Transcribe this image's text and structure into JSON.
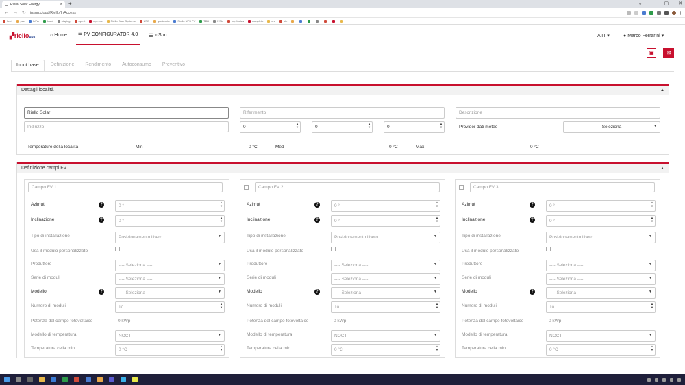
{
  "browser": {
    "tab_title": "Riello Solar Energy",
    "url": "insun.cloud/Riello/InAccess",
    "bookmarks": [
      "fleet",
      "pvc",
      "IUFA",
      "Inout",
      "staging",
      "ope.it",
      "ope.rec",
      "Riello Ener Systems",
      "UPE",
      "qualentria",
      "Riello UPS PV",
      "TBD",
      "NSU",
      "my.Kodies",
      "completo",
      "cre",
      "ote",
      "",
      "",
      "",
      "",
      "",
      "",
      ""
    ]
  },
  "app": {
    "menu": {
      "home": "Home",
      "configurator": "PV CONFIGURATOR 4.0",
      "insun": "inSun"
    },
    "lang": "IT",
    "user": "Marco Ferrarini"
  },
  "tabs": [
    "Input base",
    "Definizione",
    "Rendimento",
    "Autoconsumo",
    "Preventivo"
  ],
  "location_panel": {
    "title": "Dettagli località",
    "name_value": "Riello Solar",
    "reference_placeholder": "Riferimento",
    "description_placeholder": "Descrizione",
    "address_placeholder": "Indirizzo",
    "coords": [
      "0",
      "0",
      "0"
    ],
    "provider_label": "Provider dati meteo",
    "provider_value": "---- Seleziona ----",
    "temp_label": "Temperature della località",
    "min_label": "Min",
    "min_value": "0 °C",
    "med_label": "Med",
    "med_value": "0 °C",
    "max_label": "Max",
    "max_value": "0 °C"
  },
  "fields_panel": {
    "title": "Definizione campi FV",
    "labels": {
      "azimut": "Azimut",
      "inclinazione": "Inclinazione",
      "tipo": "Tipo di installazione",
      "usa_modulo": "Usa il modulo personalizzato",
      "produttore": "Produttore",
      "serie": "Serie di moduli",
      "modello": "Modello",
      "numero": "Numero di moduli",
      "potenza": "Potenza del campo fotovoltaico",
      "modello_temp": "Modello di temperatura",
      "temp_cella": "Temperatura cella min"
    },
    "cards": [
      {
        "name": "Campo FV 1",
        "azimut": "0 °",
        "inclinazione": "0 °",
        "tipo": "Posizionamento libero",
        "produttore": "---- Seleziona ----",
        "serie": "---- Seleziona ----",
        "modello": "---- Seleziona ----",
        "numero": "10",
        "potenza": "0 kWp",
        "modello_temp": "NOCT",
        "temp_cella": "0 °C"
      },
      {
        "name": "Campo FV 2",
        "azimut": "0 °",
        "inclinazione": "0 °",
        "tipo": "Posizionamento libero",
        "produttore": "---- Seleziona ----",
        "serie": "---- Seleziona ----",
        "modello": "---- Seleziona ----",
        "numero": "10",
        "potenza": "0 kWp",
        "modello_temp": "NOCT",
        "temp_cella": "0 °C"
      },
      {
        "name": "Campo FV 3",
        "azimut": "0 °",
        "inclinazione": "0 °",
        "tipo": "Posizionamento libero",
        "produttore": "---- Seleziona ----",
        "serie": "---- Seleziona ----",
        "modello": "---- Seleziona ----",
        "numero": "10",
        "potenza": "0 kWp",
        "modello_temp": "NOCT",
        "temp_cella": "0 °C"
      }
    ]
  },
  "colors": {
    "accent": "#c8102e",
    "brand_blue": "#1a3a8a",
    "taskbar": "#1f1f3a"
  }
}
